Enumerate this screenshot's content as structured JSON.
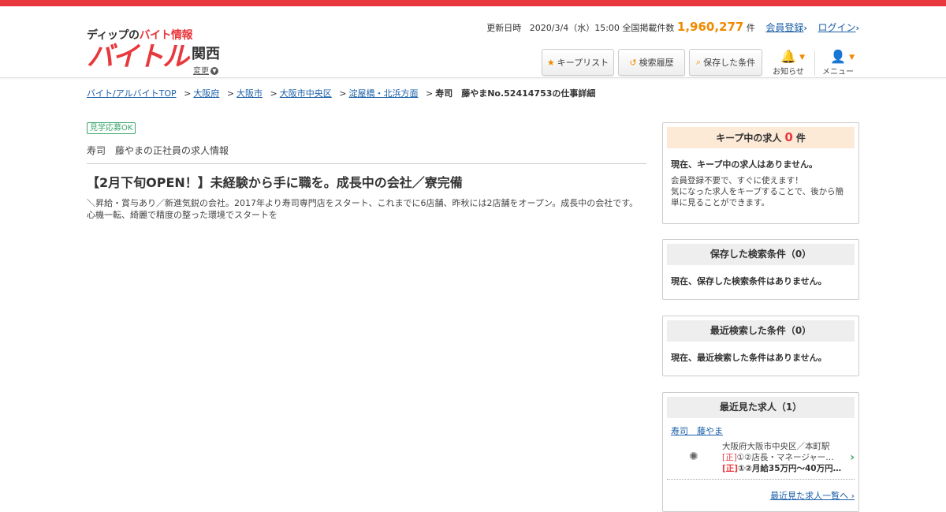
{
  "header": {
    "logo_sub_prefix": "ディップの",
    "logo_sub_accent": "バイト情報",
    "logo_main": "バイトル",
    "region": "関西",
    "region_change": "変更",
    "updated_label": "更新日時",
    "updated_value": "2020/3/4（水）15:00",
    "count_label": "全国掲載件数",
    "count_value": "1,960,277",
    "count_unit": "件",
    "register_link": "会員登録",
    "login_link": "ログイン",
    "keep_list_label": "キープリスト",
    "history_label": "検索履歴",
    "saved_label": "保存した条件",
    "notice_label": "お知らせ",
    "menu_label": "メニュー"
  },
  "breadcrumb": {
    "items": [
      "バイト/アルバイトTOP",
      "大阪府",
      "大阪市",
      "大阪市中央区",
      "淀屋橋・北浜方面"
    ],
    "current": "寿司　藤やまNo.52414753の仕事詳細"
  },
  "job": {
    "badge": "見学応募OK",
    "company_line": "寿司　藤やまの正社員の求人情報",
    "title": "【2月下旬OPEN！】未経験から手に職を。成長中の会社／寮完備",
    "description": "＼昇給・賞与あり／新進気鋭の会社。2017年より寿司専門店をスタート、これまでに6店舗、昨秋には2店舗をオープン。成長中の会社です。心機一転、綺麗で精度の整った環境でスタートを"
  },
  "sidebar": {
    "keep": {
      "head_prefix": "キープ中の求人",
      "head_count": "0",
      "head_unit": "件",
      "message": "現在、キープ中の求人はありません。",
      "sub": "会員登録不要で、すぐに使えます！\n気になった求人をキープすることで、後から簡単に見ることができます。"
    },
    "saved": {
      "head": "保存した検索条件（0）",
      "message": "現在、保存した検索条件はありません。"
    },
    "recent_search": {
      "head": "最近検索した条件（0）",
      "message": "現在、最近検索した条件はありません。"
    },
    "recent_viewed": {
      "head": "最近見た求人（1）",
      "link": "寿司　藤やま",
      "location": "大阪府大阪市中央区／本町駅",
      "tag": "[正]",
      "role": "①②店長・マネージャー…",
      "pay": "①②月給35万円～40万円…",
      "more": "最近見た求人一覧へ"
    }
  },
  "colors": {
    "brand_red": "#e8383d",
    "accent_orange": "#f08a00",
    "link_blue": "#1a5fa8",
    "badge_green": "#3aa66b"
  }
}
